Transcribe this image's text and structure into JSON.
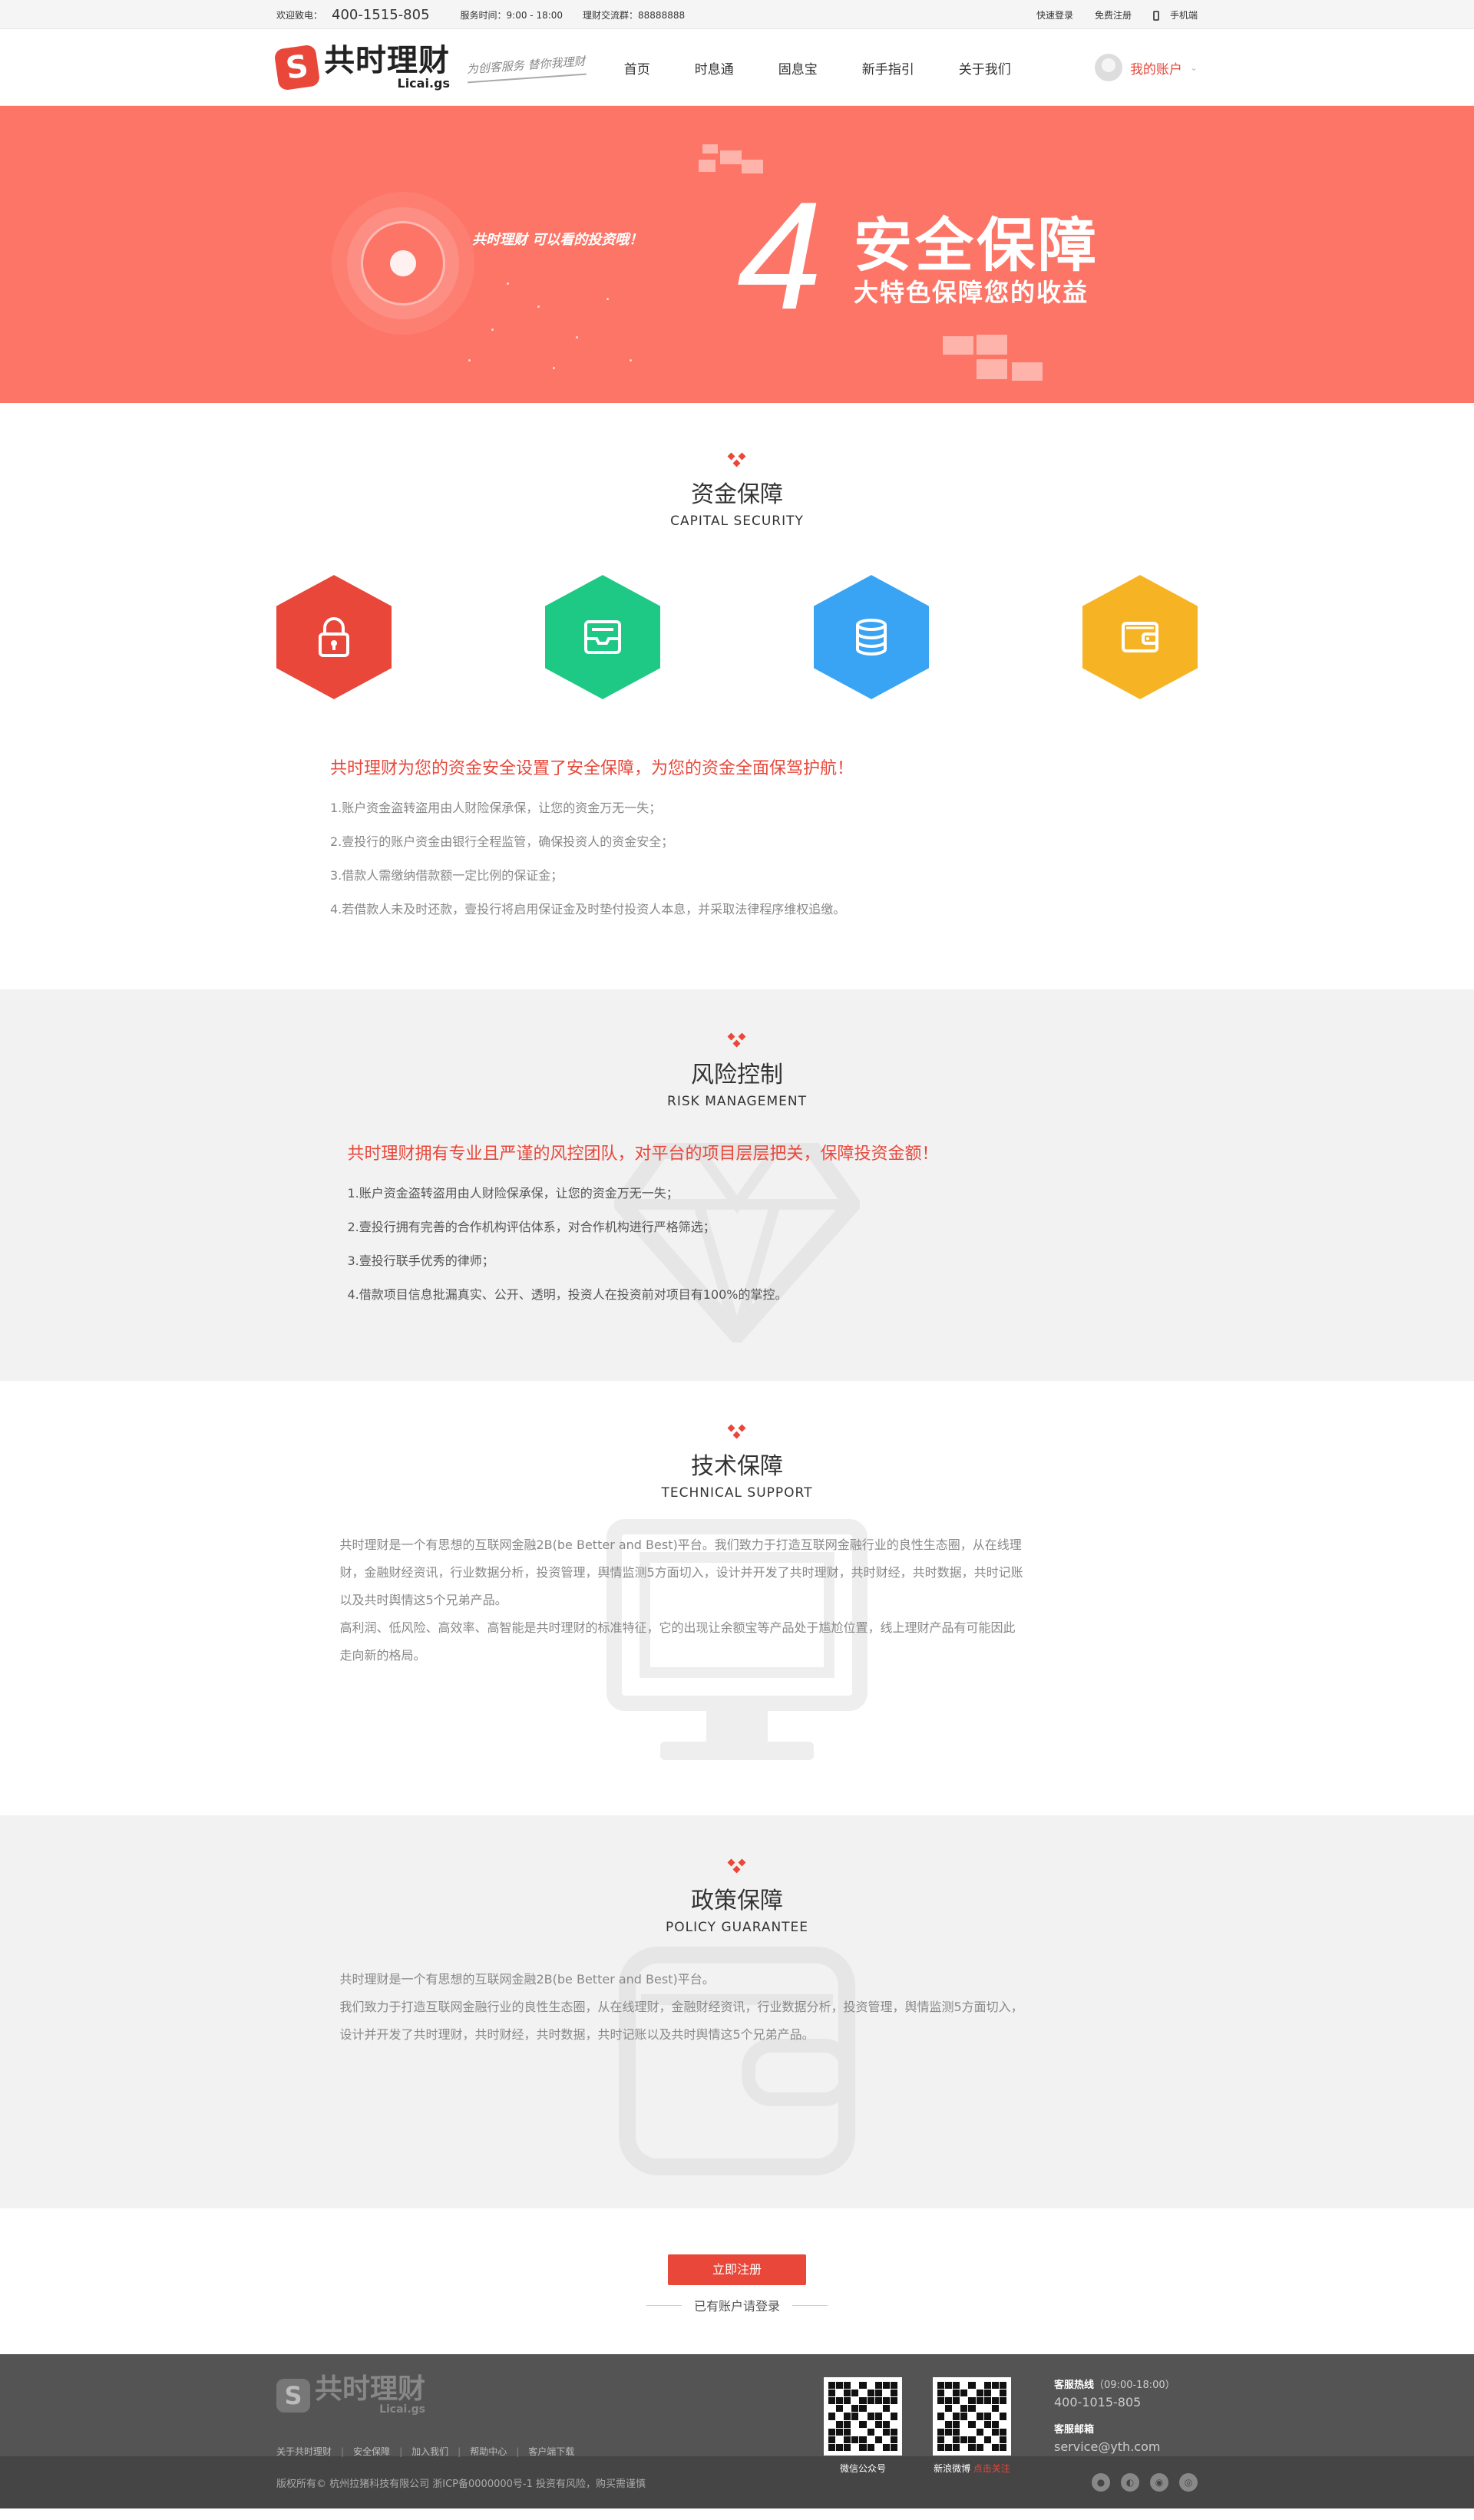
{
  "topbar": {
    "welcome": "欢迎致电：",
    "phone": "400-1515-805",
    "service_hours": "服务时间：9:00 - 18:00",
    "group": "理财交流群：88888888",
    "quick_login": "快速登录",
    "register": "免费注册",
    "mobile": "手机端"
  },
  "header": {
    "logo_mark": "S",
    "logo_cn": "共时理财",
    "logo_en": "Licai.gs",
    "slogan": "为创客服务 替你我理财",
    "nav": [
      "首页",
      "时息通",
      "固息宝",
      "新手指引",
      "关于我们"
    ],
    "account": "我的账户"
  },
  "banner": {
    "tagline": "共时理财  可以看的投资哦！",
    "number": "4",
    "title": "安全保障",
    "subtitle": "大特色保障您的收益"
  },
  "capital": {
    "title_cn": "资金保障",
    "title_en": "CAPITAL SECURITY",
    "icons": [
      "lock-icon",
      "inbox-icon",
      "database-icon",
      "wallet-icon"
    ],
    "colors": [
      "#e8473a",
      "#1ec885",
      "#3aa4f4",
      "#f6b425"
    ],
    "headline": "共时理财为您的资金安全设置了安全保障，为您的资金全面保驾护航！",
    "items": [
      "1.账户资金盗转盗用由人财险保承保，让您的资金万无一失；",
      "2.壹投行的账户资金由银行全程监管，确保投资人的资金安全；",
      "3.借款人需缴纳借款额一定比例的保证金；",
      "4.若借款人未及时还款，壹投行将启用保证金及时垫付投资人本息，并采取法律程序维权追缴。"
    ]
  },
  "risk": {
    "title_cn": "风险控制",
    "title_en": "RISK MANAGEMENT",
    "headline": "共时理财拥有专业且严谨的风控团队，对平台的项目层层把关，保障投资金额！",
    "items": [
      "1.账户资金盗转盗用由人财险保承保，让您的资金万无一失；",
      "2.壹投行拥有完善的合作机构评估体系，对合作机构进行严格筛选；",
      "3.壹投行联手优秀的律师；",
      "4.借款项目信息批漏真实、公开、透明，投资人在投资前对项目有100%的掌控。"
    ]
  },
  "tech": {
    "title_cn": "技术保障",
    "title_en": "TECHNICAL SUPPORT",
    "lines": [
      "共时理财是一个有思想的互联网金融2B(be Better and Best)平台。我们致力于打造互联网金融行业的良性生态圈，从在线理",
      "财，金融财经资讯，行业数据分析，投资管理，舆情监测5方面切入，设计并开发了共时理财，共时财经，共时数据，共时记账",
      "以及共时舆情这5个兄弟产品。",
      "高利润、低风险、高效率、高智能是共时理财的标准特征，它的出现让余额宝等产品处于尴尬位置，线上理财产品有可能因此",
      "走向新的格局。"
    ]
  },
  "policy": {
    "title_cn": "政策保障",
    "title_en": "POLICY GUARANTEE",
    "lines": [
      "共时理财是一个有思想的互联网金融2B(be Better and Best)平台。",
      "我们致力于打造互联网金融行业的良性生态圈，从在线理财，金融财经资讯，行业数据分析，投资管理，舆情监测5方面切入，",
      "设计并开发了共时理财，共时财经，共时数据，共时记账以及共时舆情这5个兄弟产品。"
    ]
  },
  "register": {
    "button": "立即注册",
    "login": "已有账户请登录"
  },
  "footer": {
    "logo_cn": "共时理财",
    "logo_en": "Licai.gs",
    "links": [
      "关于共时理财",
      "安全保障",
      "加入我们",
      "帮助中心",
      "客户端下载"
    ],
    "sep": "|",
    "qr_wechat": "微信公众号",
    "qr_weibo": "新浪微博",
    "qr_weibo_follow": "点击关注",
    "hotline_label": "客服热线",
    "hotline_hours": "（09:00-18:00）",
    "hotline": "400-1015-805",
    "email_label": "客服邮箱",
    "email": "service@yth.com",
    "copyright": "版权所有© 杭州拉猪科技有限公司 浙ICP备0000000号-1 投资有风险，购买需谨慎"
  }
}
